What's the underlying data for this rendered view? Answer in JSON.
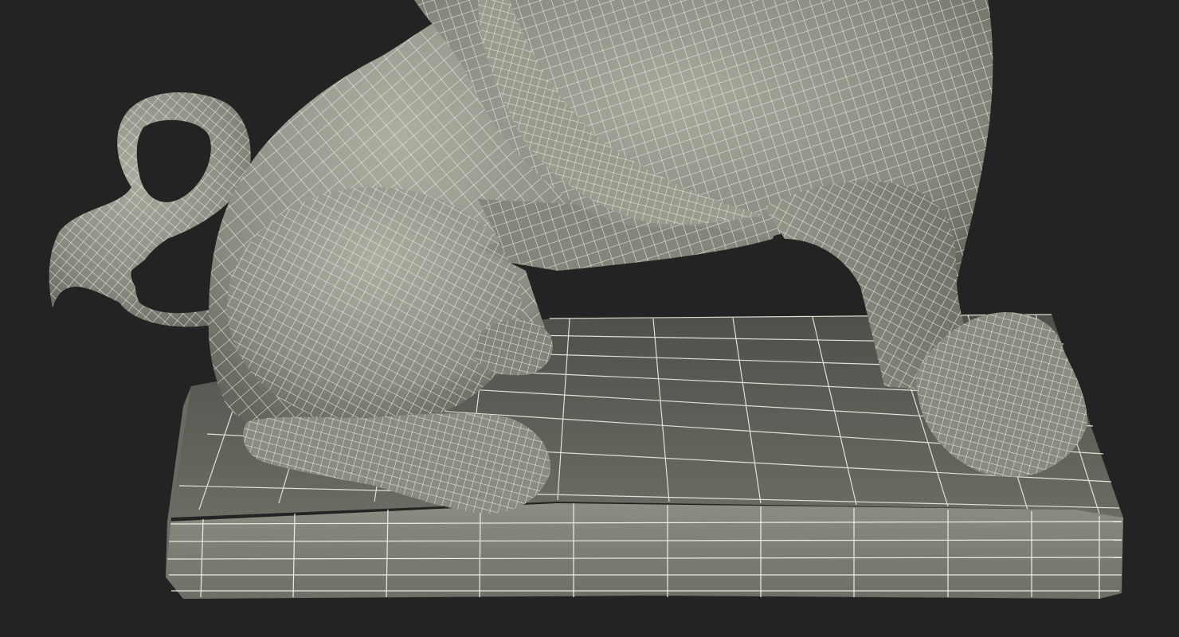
{
  "scene": {
    "background_color": "#232323",
    "mesh_fill_color": "#84857a",
    "mesh_fill_light": "#a7a89c",
    "mesh_fill_dark": "#5f6057",
    "wire_color": "#eeeee4",
    "subject": "wireframe-lion-statue-on-base"
  }
}
